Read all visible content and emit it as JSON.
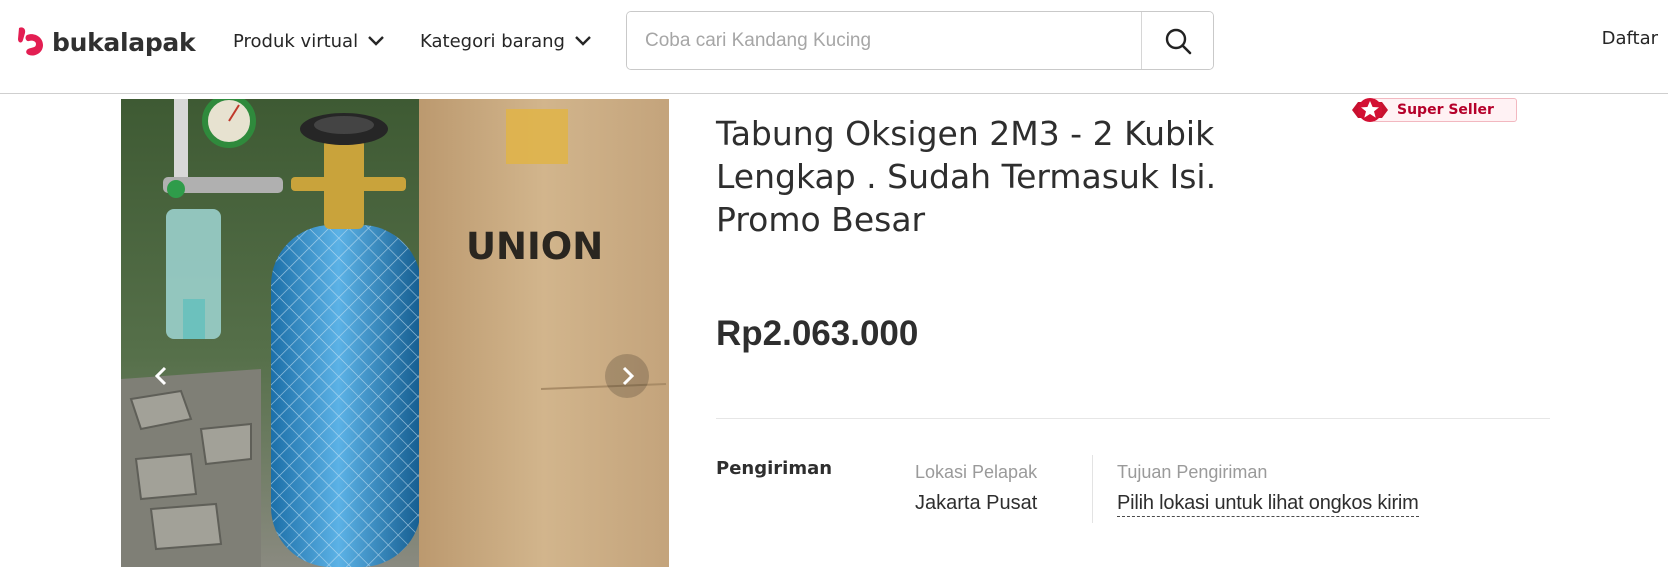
{
  "header": {
    "logo_text": "bukalapak",
    "nav": [
      {
        "label": "Produk virtual",
        "icon": "chevron-down-icon"
      },
      {
        "label": "Kategori barang",
        "icon": "chevron-down-icon"
      }
    ],
    "search": {
      "placeholder": "Coba cari Kandang Kucing",
      "value": "",
      "icon": "search-icon"
    },
    "register_label": "Daftar"
  },
  "gallery": {
    "image": "product-photo",
    "box_label": "UNION",
    "prev_icon": "chevron-left-icon",
    "next_icon": "chevron-right-icon"
  },
  "product": {
    "title": "Tabung Oksigen 2M3 - 2 Kubik Lengkap . Sudah Termasuk Isi. Promo Besar",
    "badge": "Super Seller",
    "price": "Rp2.063.000"
  },
  "shipping": {
    "label": "Pengiriman",
    "location_label": "Lokasi Pelapak",
    "location_value": "Jakarta Pusat",
    "destination_label": "Tujuan Pengiriman",
    "destination_link": "Pilih lokasi untuk lihat ongkos kirim"
  },
  "colors": {
    "brand": "#e31e52",
    "badge_text": "#b5002a",
    "text": "#2e2e2e",
    "muted": "#9a9a9a"
  }
}
